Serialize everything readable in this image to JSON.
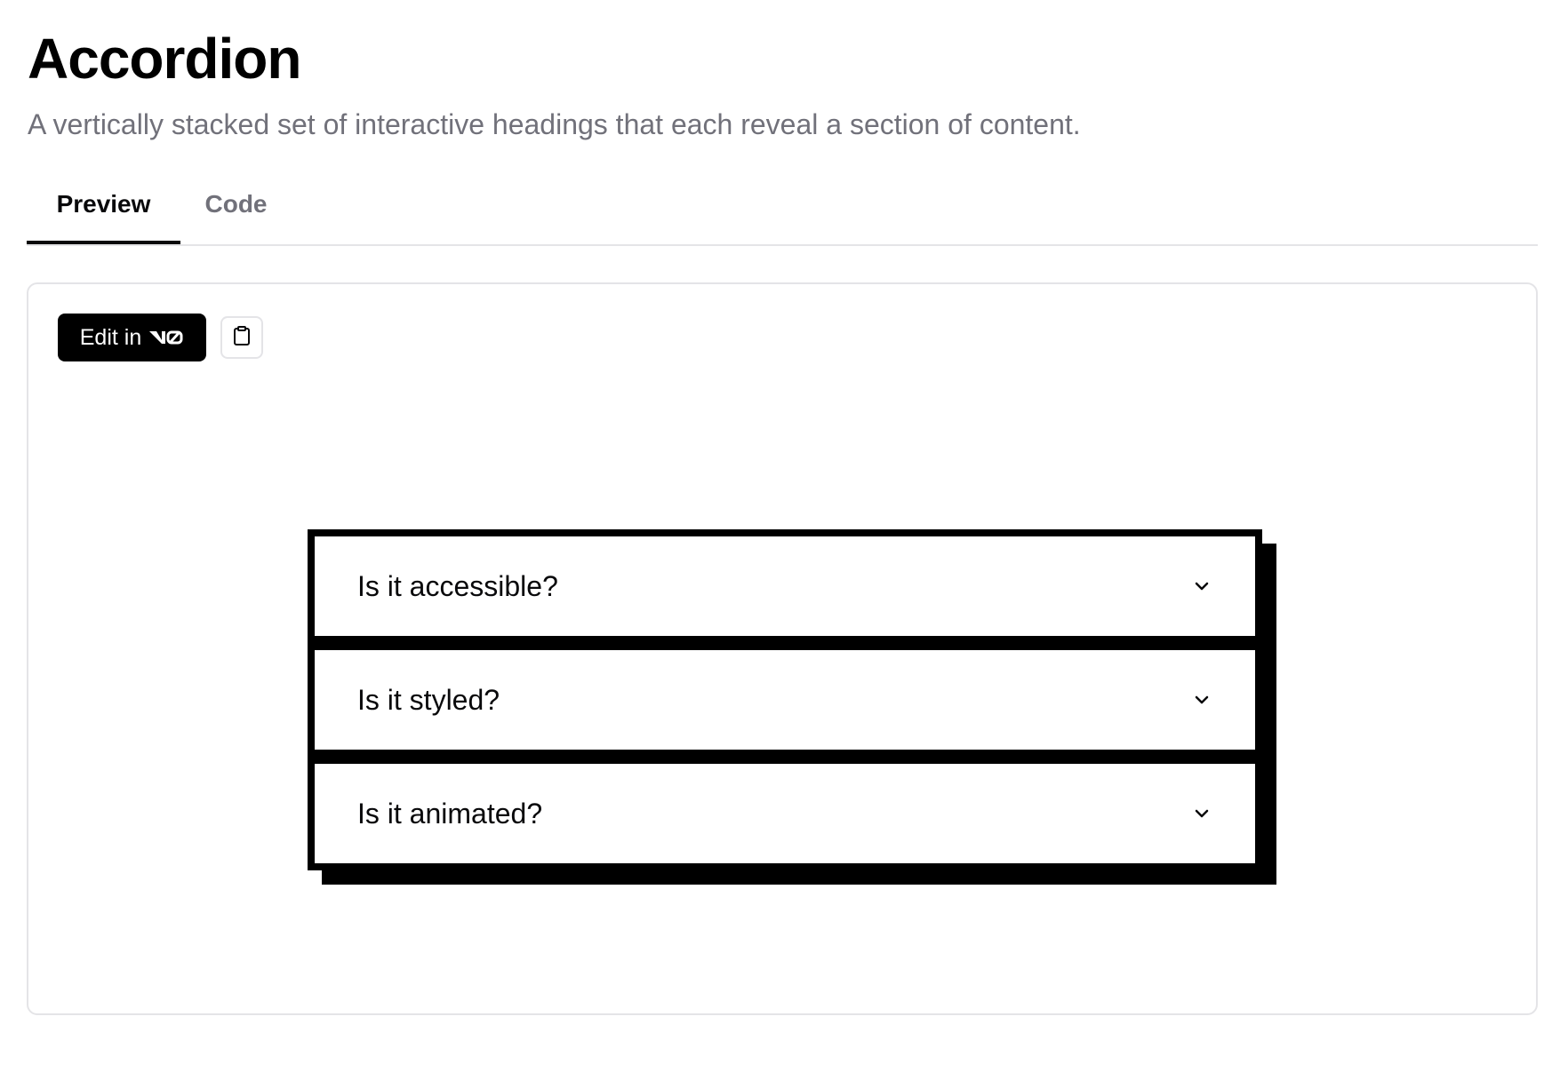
{
  "header": {
    "title": "Accordion",
    "subtitle": "A vertically stacked set of interactive headings that each reveal a section of content."
  },
  "tabs": [
    {
      "label": "Preview",
      "active": true
    },
    {
      "label": "Code",
      "active": false
    }
  ],
  "preview": {
    "edit_button_label": "Edit in",
    "edit_button_logo": "v0-logo",
    "copy_button_icon": "clipboard-icon"
  },
  "accordion": {
    "items": [
      {
        "label": "Is it accessible?",
        "icon": "chevron-down-icon"
      },
      {
        "label": "Is it styled?",
        "icon": "chevron-down-icon"
      },
      {
        "label": "Is it animated?",
        "icon": "chevron-down-icon"
      }
    ]
  },
  "colors": {
    "text_primary": "#09090b",
    "text_muted": "#71717a",
    "border": "#e4e4e7",
    "accent_black": "#000000",
    "background": "#ffffff"
  }
}
